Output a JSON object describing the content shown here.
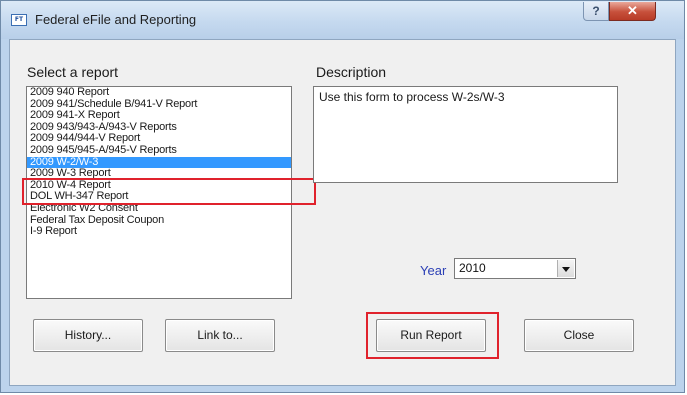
{
  "window": {
    "title": "Federal eFile and Reporting",
    "app_icon_text": "FT",
    "help_glyph": "?",
    "close_glyph": "✕"
  },
  "select_label": "Select a report",
  "reports": [
    "2009 940 Report",
    "2009 941/Schedule B/941-V Report",
    "2009 941-X Report",
    "2009 943/943-A/943-V Reports",
    "2009 944/944-V Report",
    "2009 945/945-A/945-V Reports",
    "2009 W-2/W-3",
    "2009 W-3 Report",
    "2010 W-4 Report",
    "DOL WH-347 Report",
    "Electronic W2 Consent",
    "Federal Tax Deposit Coupon",
    "I-9 Report"
  ],
  "selected_report": "2009 W-2/W-3",
  "description_label": "Description",
  "description_text": "Use this form to process W-2s/W-3",
  "year_label": "Year",
  "year_value": "2010",
  "buttons": {
    "history": "History...",
    "link_to": "Link to...",
    "run_report": "Run Report",
    "close": "Close"
  },
  "colors": {
    "selection": "#3399ff",
    "highlight": "#e0222c",
    "year_label": "#2b3fb5"
  }
}
